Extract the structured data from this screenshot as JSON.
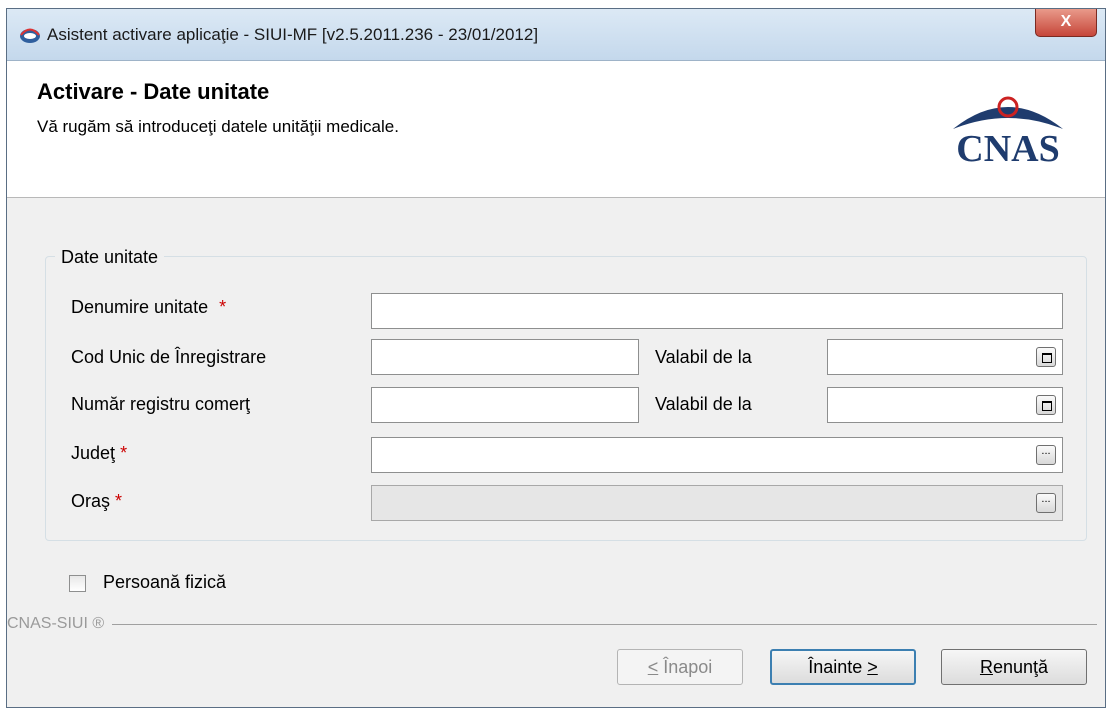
{
  "window": {
    "title": "Asistent activare aplicaţie - SIUI-MF [v2.5.2011.236 - 23/01/2012]",
    "close_label": "X"
  },
  "header": {
    "title": "Activare - Date unitate",
    "subtitle": "Vă rugăm să introduceţi datele unităţii medicale.",
    "logo_text": "CNAS"
  },
  "group": {
    "title": "Date unitate",
    "denumire_label": "Denumire unitate",
    "cui_label": "Cod Unic de Înregistrare",
    "valabil1_label": "Valabil de la",
    "nrc_label": "Număr registru comerţ",
    "valabil2_label": "Valabil de la",
    "judet_label": "Judeţ",
    "oras_label": "Oraş",
    "required_mark": "*",
    "ellipsis": "..."
  },
  "checkbox": {
    "label": "Persoană fizică"
  },
  "footer": {
    "brand": "CNAS-SIUI ®",
    "back_prefix": "<",
    "back_rest": " Înapoi",
    "next_main": "Înainte ",
    "next_suffix": ">",
    "cancel_first": "R",
    "cancel_rest": "enunţă"
  },
  "colors": {
    "accent": "#3c7fb1",
    "required": "#cc0000",
    "logo": "#1f3c6e"
  }
}
